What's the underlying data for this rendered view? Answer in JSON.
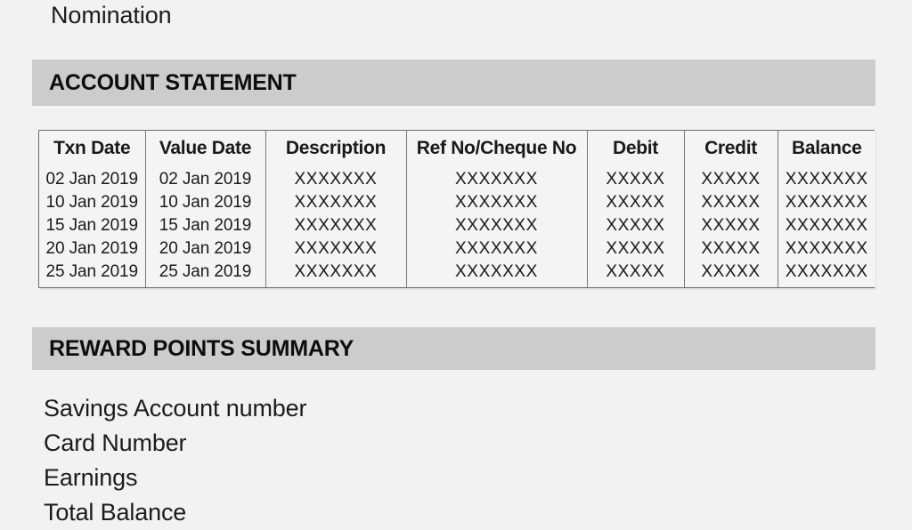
{
  "page": {
    "background_color": "#f2f2f2",
    "band_color": "#cccccc",
    "text_color": "#1a1a1a"
  },
  "document_line": {
    "label": "Nomination"
  },
  "sections": {
    "account_statement": {
      "band_title": "ACCOUNT STATEMENT"
    },
    "reward_points": {
      "band_title": "REWARD POINTS SUMMARY"
    }
  },
  "statement_table": {
    "columns": [
      "Txn Date",
      "Value Date",
      "Description",
      "Ref No/Cheque No",
      "Debit",
      "Credit",
      "Balance"
    ],
    "rows": [
      {
        "txn_date": "02 Jan 2019",
        "value_date": "02 Jan 2019",
        "description": "XXXXXXX",
        "ref_no": "XXXXXXX",
        "debit": "XXXXX",
        "credit": "XXXXX",
        "balance": "XXXXXXX"
      },
      {
        "txn_date": "10 Jan 2019",
        "value_date": "10 Jan 2019",
        "description": "XXXXXXX",
        "ref_no": "XXXXXXX",
        "debit": "XXXXX",
        "credit": "XXXXX",
        "balance": "XXXXXXX"
      },
      {
        "txn_date": "15 Jan 2019",
        "value_date": "15 Jan 2019",
        "description": "XXXXXXX",
        "ref_no": "XXXXXXX",
        "debit": "XXXXX",
        "credit": "XXXXX",
        "balance": "XXXXXXX"
      },
      {
        "txn_date": "20 Jan 2019",
        "value_date": "20 Jan 2019",
        "description": "XXXXXXX",
        "ref_no": "XXXXXXX",
        "debit": "XXXXX",
        "credit": "XXXXX",
        "balance": "XXXXXXX"
      },
      {
        "txn_date": "25 Jan 2019",
        "value_date": "25 Jan 2019",
        "description": "XXXXXXX",
        "ref_no": "XXXXXXX",
        "debit": "XXXXX",
        "credit": "XXXXX",
        "balance": "XXXXXXX"
      }
    ]
  },
  "reward_points_list": [
    "Savings Account number",
    "Card Number",
    "Earnings",
    "Total Balance"
  ]
}
